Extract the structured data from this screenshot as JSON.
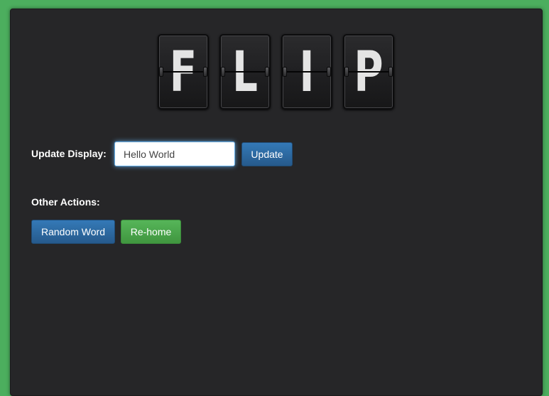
{
  "display": {
    "tiles": [
      "F",
      "L",
      "I",
      "P"
    ]
  },
  "update": {
    "label": "Update Display:",
    "input_value": "Hello World",
    "button_label": "Update"
  },
  "other_actions": {
    "label": "Other Actions:",
    "random_button_label": "Random Word",
    "rehome_button_label": "Re-home"
  },
  "colors": {
    "page_background": "#4cae5e",
    "panel_background": "#262628",
    "primary_button": "#2d6aa3",
    "success_button": "#4cae50"
  }
}
